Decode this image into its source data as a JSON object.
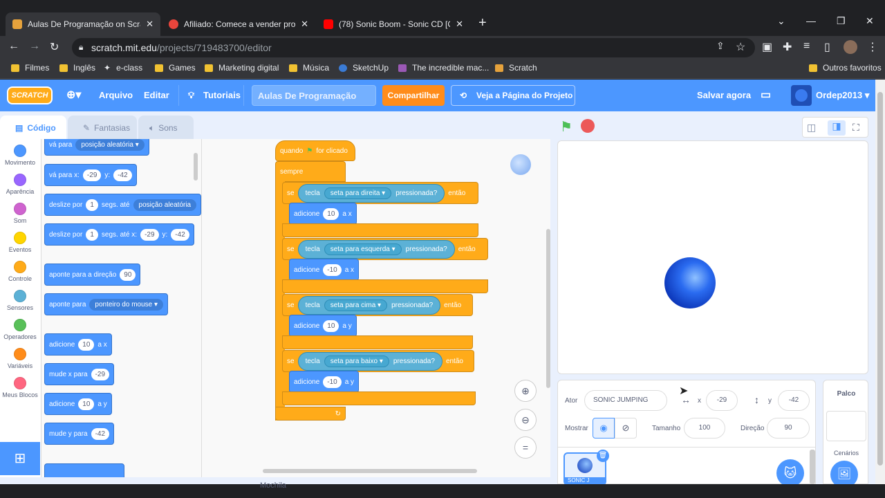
{
  "browser": {
    "tabs": [
      {
        "title": "Aulas De Programação on Scratch",
        "active": true
      },
      {
        "title": "Afiliado: Comece a vender produtos",
        "active": false
      },
      {
        "title": "(78) Sonic Boom - Sonic CD [OST]",
        "active": false
      }
    ],
    "url_host": "scratch.mit.edu",
    "url_path": "/projects/719483700/editor",
    "bookmarks": [
      "Filmes",
      "Inglês",
      "e-class",
      "Games",
      "Marketing digital",
      "Música",
      "SketchUp",
      "The incredible mac...",
      "Scratch"
    ],
    "other_bookmarks": "Outros favoritos"
  },
  "menu": {
    "logo": "SCRATCH",
    "file": "Arquivo",
    "edit": "Editar",
    "tutorials": "Tutoriais",
    "project_title": "Aulas De Programação",
    "share": "Compartilhar",
    "see_project": "Veja a Página do Projeto",
    "save_now": "Salvar agora",
    "username": "Ordep2013"
  },
  "editor_tabs": {
    "code": "Código",
    "costumes": "Fantasias",
    "sounds": "Sons"
  },
  "categories": [
    {
      "label": "Movimento",
      "color": "#4c97ff"
    },
    {
      "label": "Aparência",
      "color": "#9966ff"
    },
    {
      "label": "Som",
      "color": "#cf63cf"
    },
    {
      "label": "Eventos",
      "color": "#ffd500"
    },
    {
      "label": "Controle",
      "color": "#ffab19"
    },
    {
      "label": "Sensores",
      "color": "#5cb1d6"
    },
    {
      "label": "Operadores",
      "color": "#59c059"
    },
    {
      "label": "Variáveis",
      "color": "#ff8c1a"
    },
    {
      "label": "Meus Blocos",
      "color": "#ff6680"
    }
  ],
  "palette": {
    "goto": "vá para",
    "goto_opt": "posição aleatória",
    "goto_xy": "vá para x:",
    "x_val": "-29",
    "y_lbl": "y:",
    "y_val": "-42",
    "glide": "deslize por",
    "glide_secs": "1",
    "glide_to": "segs. até",
    "glide_opt": "posição aleatória",
    "glide_xy_to": "segs. até x:",
    "point": "aponte  para a direção",
    "point_val": "90",
    "point_to": "aponte para",
    "point_opt": "ponteiro do mouse",
    "change_x": "adicione",
    "change_x_val": "10",
    "change_x_suffix": "a x",
    "set_x": "mude x para",
    "set_x_val": "-29",
    "change_y": "adicione",
    "change_y_val": "10",
    "change_y_suffix": "a y",
    "set_y": "mude y para",
    "set_y_val": "-42"
  },
  "script": {
    "hat": "quando",
    "hat_suffix": "for clicado",
    "forever": "sempre",
    "if": "se",
    "then": "então",
    "key": "tecla",
    "pressed": "pressionada?",
    "add": "adicione",
    "rules": [
      {
        "key": "seta para direita",
        "value": "10",
        "axis": "a x"
      },
      {
        "key": "seta para esquerda",
        "value": "-10",
        "axis": "a x"
      },
      {
        "key": "seta para cima",
        "value": "10",
        "axis": "a y"
      },
      {
        "key": "seta para baixo",
        "value": "-10",
        "axis": "a y"
      }
    ]
  },
  "sprite_info": {
    "actor_label": "Ator",
    "actor_name": "SONIC JUMPING",
    "x_label": "x",
    "x": "-29",
    "y_label": "y",
    "y": "-42",
    "show_label": "Mostrar",
    "size_label": "Tamanho",
    "size": "100",
    "direction_label": "Direção",
    "direction": "90",
    "thumb_label": "SONIC J"
  },
  "stage_panel": {
    "title": "Palco",
    "backdrops": "Cenários"
  },
  "bottom_hint": "Mochila"
}
